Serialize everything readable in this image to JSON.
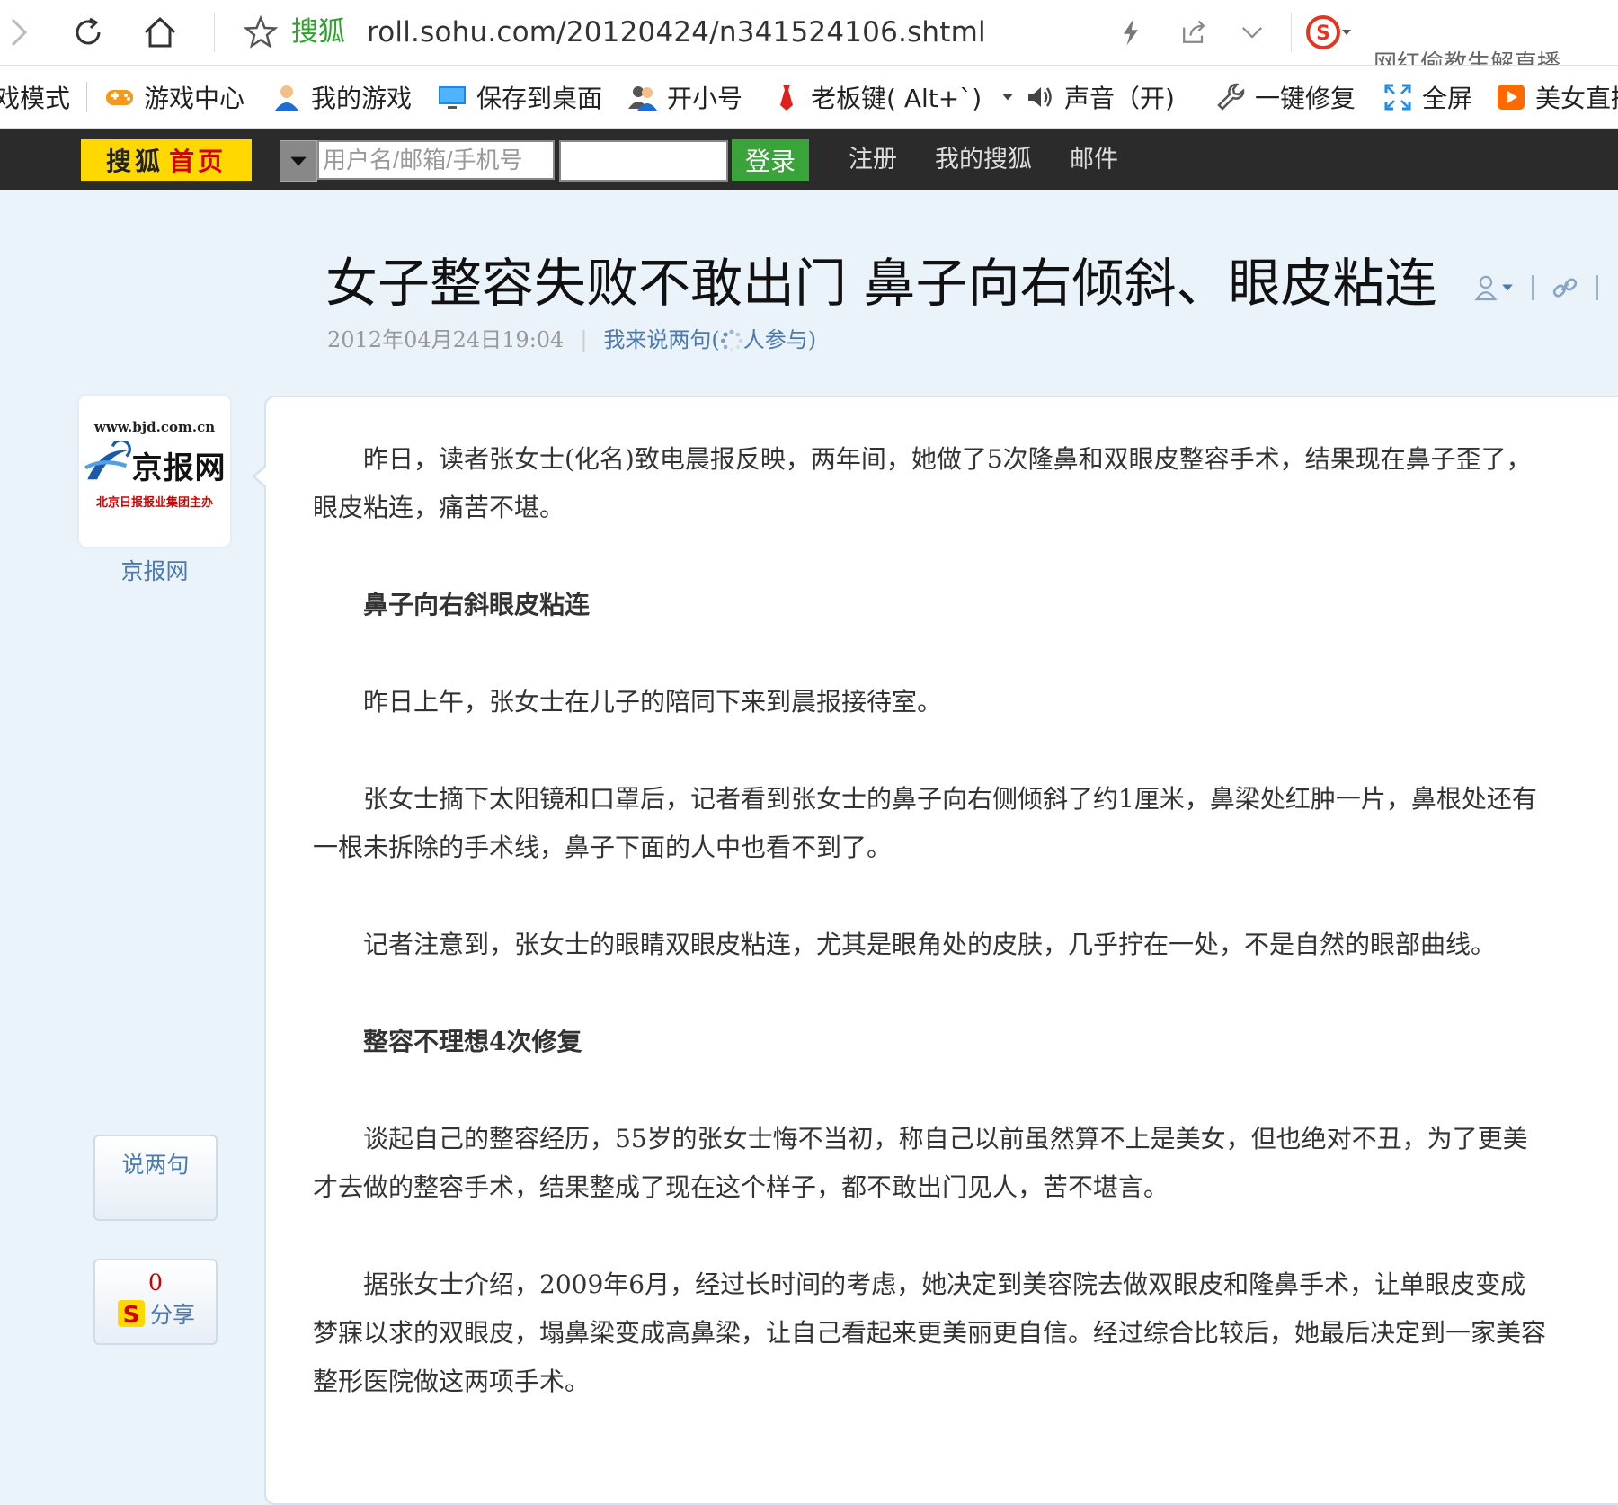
{
  "browser": {
    "site_name": "搜狐",
    "url": "roll.sohu.com/20120424/n341524106.shtml",
    "news_ticker": "网红偷教生解直播"
  },
  "bookmarks": [
    {
      "label": "戏模式",
      "icon": "none"
    },
    {
      "label": "游戏中心",
      "icon": "gamepad-icon"
    },
    {
      "label": "我的游戏",
      "icon": "user-icon"
    },
    {
      "label": "保存到桌面",
      "icon": "monitor-icon"
    },
    {
      "label": "开小号",
      "icon": "users-icon"
    },
    {
      "label": "老板键( Alt+`)",
      "icon": "tie-icon"
    },
    {
      "label": "声音（开)",
      "icon": "speaker-icon"
    },
    {
      "label": "一键修复",
      "icon": "wrench-icon"
    },
    {
      "label": "全屏",
      "icon": "fullscreen-icon"
    },
    {
      "label": "美女直播",
      "icon": "play-icon"
    }
  ],
  "sohu_bar": {
    "home_part1": "搜狐",
    "home_part2": "首页",
    "username_placeholder": "用户名/邮箱/手机号",
    "login": "登录",
    "register": "注册",
    "my_sohu": "我的搜狐",
    "mail": "邮件"
  },
  "article": {
    "title": "女子整容失败不敢出门 鼻子向右倾斜、眼皮粘连",
    "date": "2012年04月24日19:04",
    "comment_prefix": "我来说两句(",
    "comment_suffix": "人参与)",
    "source_url": "www.bjd.com.cn",
    "source_logo_text": "京报网",
    "source_logo_sub": "北京日报报业集团主办",
    "source": "京报网",
    "paragraphs": [
      {
        "text": "昨日，读者张女士(化名)致电晨报反映，两年间，她做了5次隆鼻和双眼皮整容手术，结果现在鼻子歪了，眼皮粘连，痛苦不堪。",
        "heading": false
      },
      {
        "text": "鼻子向右斜眼皮粘连",
        "heading": true
      },
      {
        "text": "昨日上午，张女士在儿子的陪同下来到晨报接待室。",
        "heading": false
      },
      {
        "text": "张女士摘下太阳镜和口罩后，记者看到张女士的鼻子向右侧倾斜了约1厘米，鼻梁处红肿一片，鼻根处还有一根未拆除的手术线，鼻子下面的人中也看不到了。",
        "heading": false
      },
      {
        "text": "记者注意到，张女士的眼睛双眼皮粘连，尤其是眼角处的皮肤，几乎拧在一处，不是自然的眼部曲线。",
        "heading": false
      },
      {
        "text": "整容不理想4次修复",
        "heading": true
      },
      {
        "text": "谈起自己的整容经历，55岁的张女士悔不当初，称自己以前虽然算不上是美女，但也绝对不丑，为了更美才去做的整容手术，结果整成了现在这个样子，都不敢出门见人，苦不堪言。",
        "heading": false
      },
      {
        "text": "据张女士介绍，2009年6月，经过长时间的考虑，她决定到美容院去做双眼皮和隆鼻手术，让单眼皮变成梦寐以求的双眼皮，塌鼻梁变成高鼻梁，让自己看起来更美丽更自信。经过综合比较后，她最后决定到一家美容整形医院做这两项手术。",
        "heading": false
      }
    ]
  },
  "side": {
    "comment_label": "说两句",
    "share_count": "0",
    "share_label": "分享"
  },
  "colors": {
    "page_bg": "#eaf2fa",
    "sohu_bar": "#2b2b2b",
    "sohu_yellow": "#ffd800",
    "login_green": "#3aa33a",
    "link_blue": "#4a7ab0"
  }
}
